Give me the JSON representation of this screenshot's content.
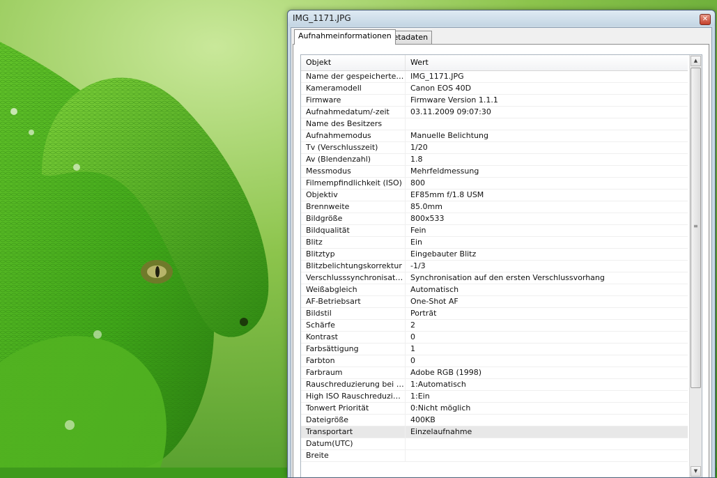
{
  "window": {
    "title": "IMG_1171.JPG"
  },
  "tabs": [
    {
      "label": "Aufnahmeinformationen",
      "active": true
    },
    {
      "label": "Metadaten",
      "active": false
    }
  ],
  "table": {
    "columns": [
      "Objekt",
      "Wert"
    ],
    "rows": [
      [
        "Name der gespeicherten Datei",
        "IMG_1171.JPG"
      ],
      [
        "Kameramodell",
        "Canon EOS 40D"
      ],
      [
        "Firmware",
        "Firmware Version 1.1.1"
      ],
      [
        "Aufnahmedatum/-zeit",
        "03.11.2009 09:07:30"
      ],
      [
        "Name des Besitzers",
        ""
      ],
      [
        "Aufnahmemodus",
        "Manuelle Belichtung"
      ],
      [
        "Tv (Verschlusszeit)",
        "1/20"
      ],
      [
        "Av (Blendenzahl)",
        "1.8"
      ],
      [
        "Messmodus",
        "Mehrfeldmessung"
      ],
      [
        "Filmempfindlichkeit (ISO)",
        "800"
      ],
      [
        "Objektiv",
        "EF85mm f/1.8 USM"
      ],
      [
        "Brennweite",
        "85.0mm"
      ],
      [
        "Bildgröße",
        "800x533"
      ],
      [
        "Bildqualität",
        "Fein"
      ],
      [
        "Blitz",
        "Ein"
      ],
      [
        "Blitztyp",
        "Eingebauter Blitz"
      ],
      [
        "Blitzbelichtungskorrektur",
        "-1/3"
      ],
      [
        "Verschlusssynchronisation",
        "Synchronisation auf den ersten Verschlussvorhang"
      ],
      [
        "Weißabgleich",
        "Automatisch"
      ],
      [
        "AF-Betriebsart",
        "One-Shot AF"
      ],
      [
        "Bildstil",
        "Porträt"
      ],
      [
        "Schärfe",
        "2"
      ],
      [
        "Kontrast",
        "0"
      ],
      [
        "Farbsättigung",
        "1"
      ],
      [
        "Farbton",
        "0"
      ],
      [
        "Farbraum",
        "Adobe RGB (1998)"
      ],
      [
        "Rauschreduzierung bei Langzeitbelichtung",
        "1:Automatisch"
      ],
      [
        "High ISO Rauschreduzierung",
        "1:Ein"
      ],
      [
        "Tonwert Priorität",
        "0:Nicht möglich"
      ],
      [
        "Dateigröße",
        "400KB"
      ],
      [
        "Transportart",
        "Einzelaufnahme"
      ],
      [
        "Datum(UTC)",
        ""
      ],
      [
        "Breite",
        ""
      ]
    ],
    "selected_row": 30
  },
  "colors": {
    "window_frame": "#c9d9e5",
    "selection": "#e8e8e8",
    "snake_green": "#3fae1f"
  }
}
